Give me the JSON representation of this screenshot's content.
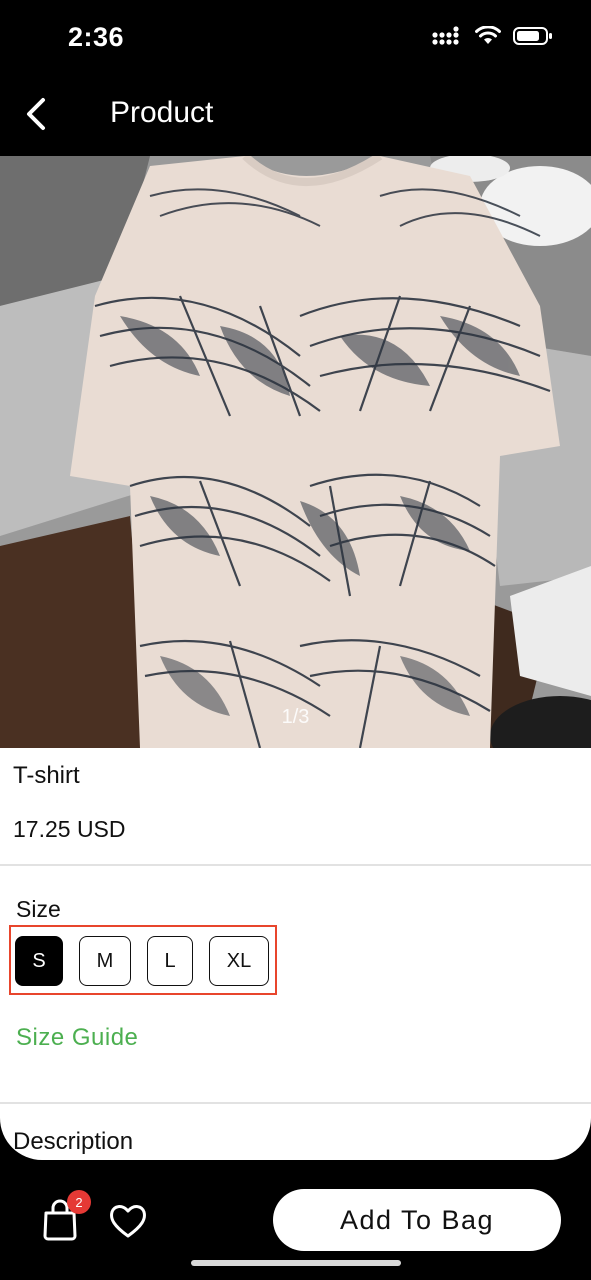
{
  "status_bar": {
    "time": "2:36",
    "icons": [
      "signal-icon",
      "wifi-icon",
      "battery-icon"
    ]
  },
  "nav": {
    "title": "Product",
    "back_icon": "chevron-left-icon"
  },
  "product": {
    "image_counter": "1/3",
    "name": "T-shirt",
    "price": "17.25 USD",
    "image_description_icon": "t-shirt-image"
  },
  "size": {
    "label": "Size",
    "options": [
      {
        "label": "S",
        "selected": true
      },
      {
        "label": "M",
        "selected": false
      },
      {
        "label": "L",
        "selected": false
      },
      {
        "label": "XL",
        "selected": false
      }
    ],
    "guide_label": "Size Guide"
  },
  "description": {
    "label": "Description"
  },
  "bottom_bar": {
    "bag_badge": "2",
    "add_to_bag_label": "Add To Bag"
  },
  "colors": {
    "accent_green": "#4caf50",
    "badge_red": "#e53935",
    "highlight_red": "#e8452c"
  }
}
